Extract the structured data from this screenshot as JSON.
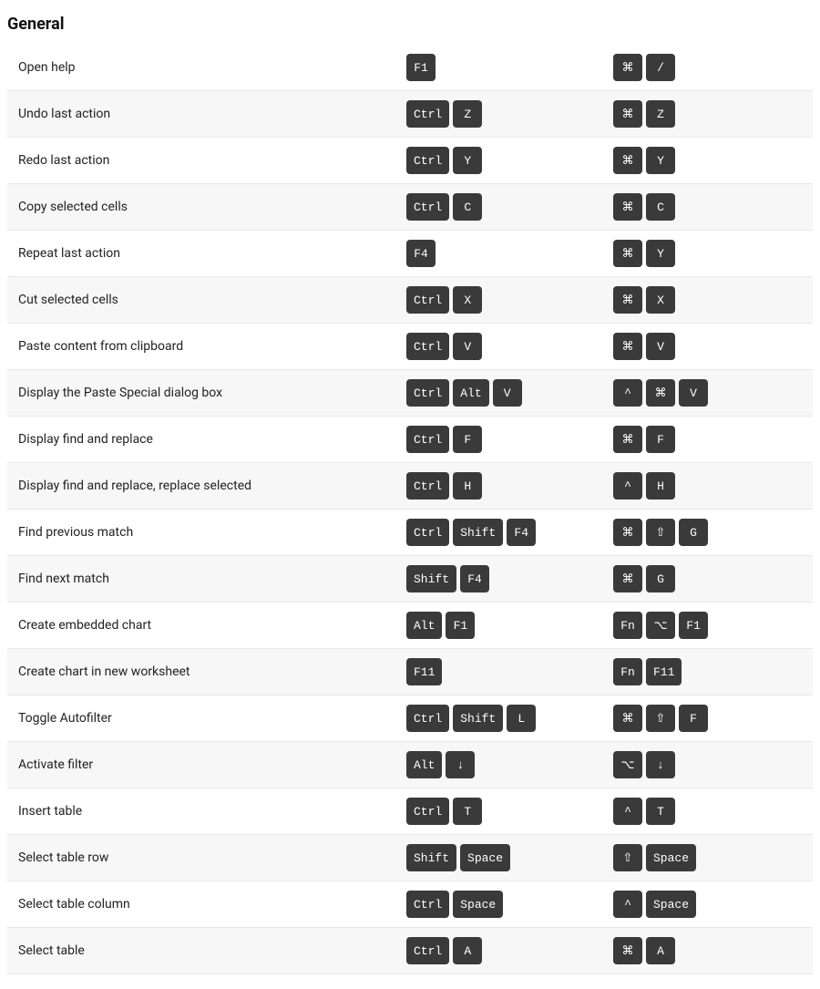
{
  "section": {
    "title": "General"
  },
  "rows": [
    {
      "action": "Open help",
      "windows_keys": [
        "F1"
      ],
      "mac_keys": [
        "⌘",
        "/"
      ]
    },
    {
      "action": "Undo last action",
      "windows_keys": [
        "Ctrl",
        "Z"
      ],
      "mac_keys": [
        "⌘",
        "Z"
      ]
    },
    {
      "action": "Redo last action",
      "windows_keys": [
        "Ctrl",
        "Y"
      ],
      "mac_keys": [
        "⌘",
        "Y"
      ]
    },
    {
      "action": "Copy selected cells",
      "windows_keys": [
        "Ctrl",
        "C"
      ],
      "mac_keys": [
        "⌘",
        "C"
      ]
    },
    {
      "action": "Repeat last action",
      "windows_keys": [
        "F4"
      ],
      "mac_keys": [
        "⌘",
        "Y"
      ]
    },
    {
      "action": "Cut selected cells",
      "windows_keys": [
        "Ctrl",
        "X"
      ],
      "mac_keys": [
        "⌘",
        "X"
      ]
    },
    {
      "action": "Paste content from clipboard",
      "windows_keys": [
        "Ctrl",
        "V"
      ],
      "mac_keys": [
        "⌘",
        "V"
      ]
    },
    {
      "action": "Display the Paste Special dialog box",
      "windows_keys": [
        "Ctrl",
        "Alt",
        "V"
      ],
      "mac_keys": [
        "^",
        "⌘",
        "V"
      ]
    },
    {
      "action": "Display find and replace",
      "windows_keys": [
        "Ctrl",
        "F"
      ],
      "mac_keys": [
        "⌘",
        "F"
      ]
    },
    {
      "action": "Display find and replace, replace selected",
      "windows_keys": [
        "Ctrl",
        "H"
      ],
      "mac_keys": [
        "^",
        "H"
      ]
    },
    {
      "action": "Find previous match",
      "windows_keys": [
        "Ctrl",
        "Shift",
        "F4"
      ],
      "mac_keys": [
        "⌘",
        "⇧",
        "G"
      ]
    },
    {
      "action": "Find next match",
      "windows_keys": [
        "Shift",
        "F4"
      ],
      "mac_keys": [
        "⌘",
        "G"
      ]
    },
    {
      "action": "Create embedded chart",
      "windows_keys": [
        "Alt",
        "F1"
      ],
      "mac_keys": [
        "Fn",
        "⌥",
        "F1"
      ]
    },
    {
      "action": "Create chart in new worksheet",
      "windows_keys": [
        "F11"
      ],
      "mac_keys": [
        "Fn",
        "F11"
      ]
    },
    {
      "action": "Toggle Autofilter",
      "windows_keys": [
        "Ctrl",
        "Shift",
        "L"
      ],
      "mac_keys": [
        "⌘",
        "⇧",
        "F"
      ]
    },
    {
      "action": "Activate filter",
      "windows_keys": [
        "Alt",
        "↓"
      ],
      "mac_keys": [
        "⌥",
        "↓"
      ]
    },
    {
      "action": "Insert table",
      "windows_keys": [
        "Ctrl",
        "T"
      ],
      "mac_keys": [
        "^",
        "T"
      ]
    },
    {
      "action": "Select table row",
      "windows_keys": [
        "Shift",
        "Space"
      ],
      "mac_keys": [
        "⇧",
        "Space"
      ]
    },
    {
      "action": "Select table column",
      "windows_keys": [
        "Ctrl",
        "Space"
      ],
      "mac_keys": [
        "^",
        "Space"
      ]
    },
    {
      "action": "Select table",
      "windows_keys": [
        "Ctrl",
        "A"
      ],
      "mac_keys": [
        "⌘",
        "A"
      ]
    }
  ]
}
